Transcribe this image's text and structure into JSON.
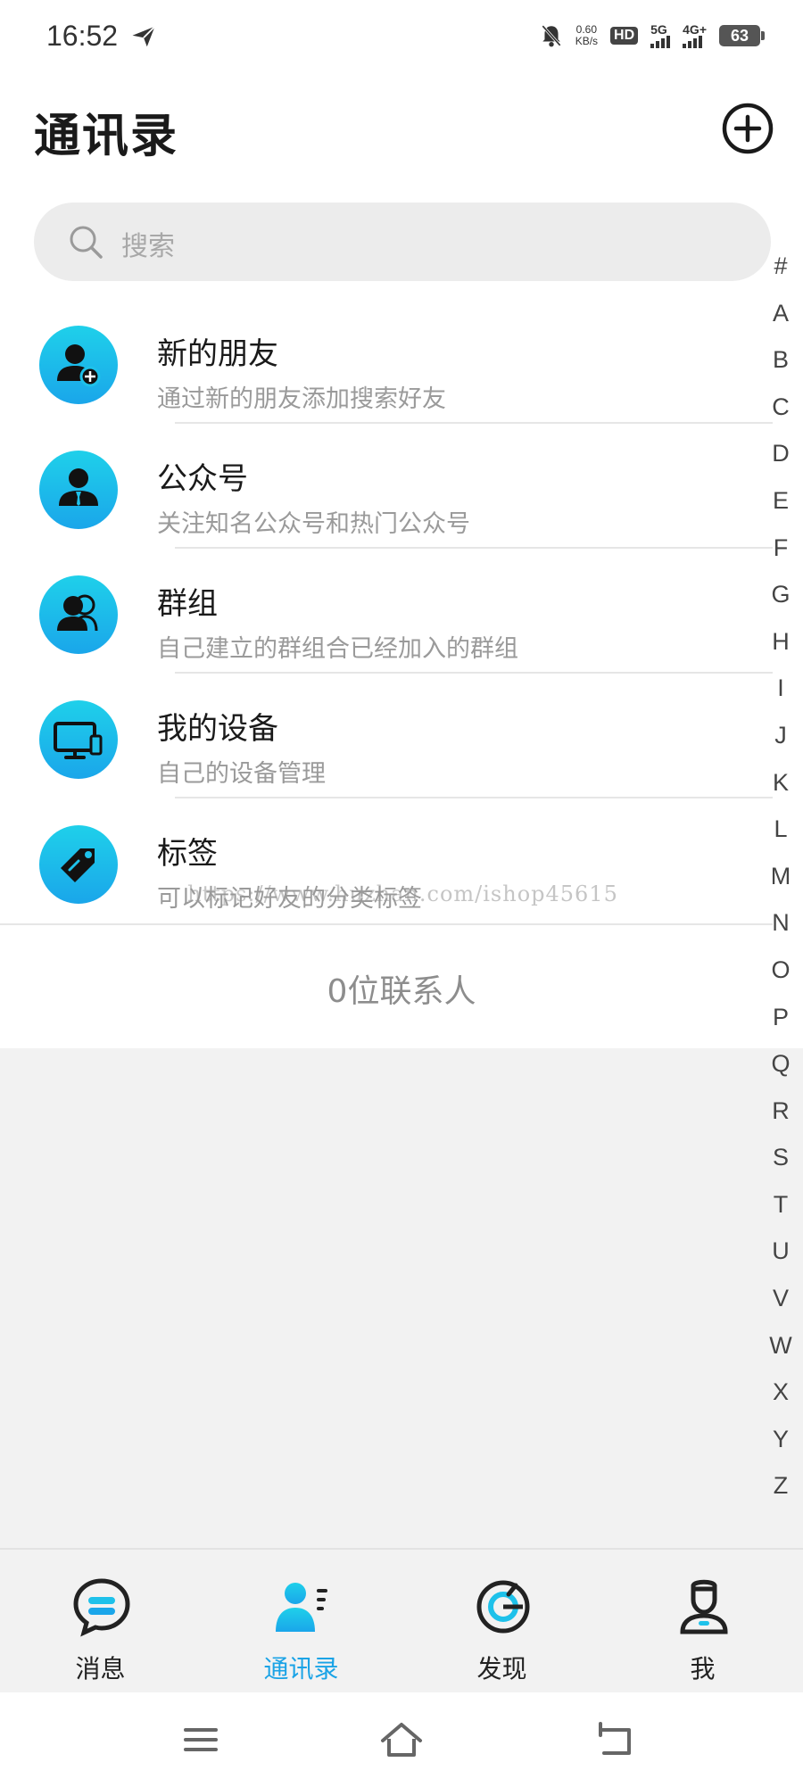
{
  "status_bar": {
    "time": "16:52",
    "net_speed_value": "0.60",
    "net_speed_unit": "KB/s",
    "hd_label": "HD",
    "sig1_label": "5G",
    "sig2_label": "4G+",
    "battery": "63"
  },
  "header": {
    "title": "通讯录"
  },
  "search": {
    "placeholder": "搜索"
  },
  "menu": [
    {
      "title": "新的朋友",
      "subtitle": "通过新的朋友添加搜索好友",
      "icon": "add-user-icon"
    },
    {
      "title": "公众号",
      "subtitle": "关注知名公众号和热门公众号",
      "icon": "official-account-icon"
    },
    {
      "title": "群组",
      "subtitle": "自己建立的群组合已经加入的群组",
      "icon": "group-icon"
    },
    {
      "title": "我的设备",
      "subtitle": "自己的设备管理",
      "icon": "device-icon"
    },
    {
      "title": "标签",
      "subtitle": "可以标记好友的分类标签",
      "icon": "tag-icon"
    }
  ],
  "watermark": "https://www.huzhan.com/ishop45615",
  "contact_count": "0位联系人",
  "alphabet": [
    "#",
    "A",
    "B",
    "C",
    "D",
    "E",
    "F",
    "G",
    "H",
    "I",
    "J",
    "K",
    "L",
    "M",
    "N",
    "O",
    "P",
    "Q",
    "R",
    "S",
    "T",
    "U",
    "V",
    "W",
    "X",
    "Y",
    "Z"
  ],
  "tabs": [
    {
      "label": "消息",
      "icon": "chat-icon",
      "active": false
    },
    {
      "label": "通讯录",
      "icon": "contacts-icon",
      "active": true
    },
    {
      "label": "发现",
      "icon": "discover-icon",
      "active": false
    },
    {
      "label": "我",
      "icon": "profile-icon",
      "active": false
    }
  ],
  "colors": {
    "accent": "#1aa3e6",
    "icon_gradient_top": "#1fd0ea",
    "icon_gradient_bottom": "#1aa6ea"
  }
}
